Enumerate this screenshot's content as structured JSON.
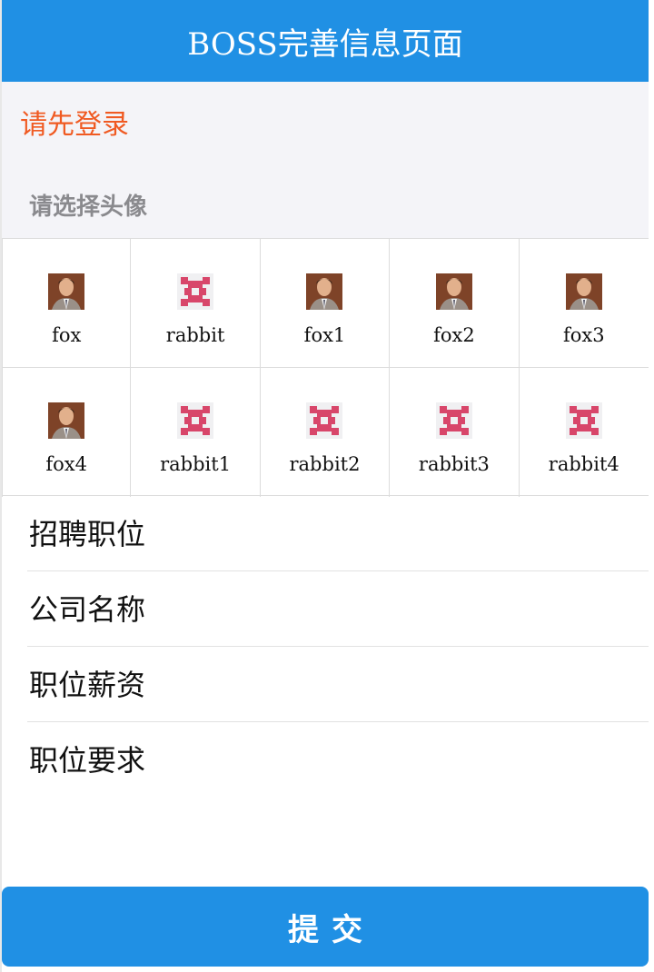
{
  "navbar": {
    "title": "BOSS完善信息页面"
  },
  "login_prompt": "请先登录",
  "avatar_section": {
    "title": "请选择头像",
    "avatars": [
      {
        "label": "fox",
        "icon": "fox-avatar-icon"
      },
      {
        "label": "rabbit",
        "icon": "rabbit-avatar-icon"
      },
      {
        "label": "fox1",
        "icon": "fox-avatar-icon"
      },
      {
        "label": "fox2",
        "icon": "fox-avatar-icon"
      },
      {
        "label": "fox3",
        "icon": "fox-avatar-icon"
      },
      {
        "label": "fox4",
        "icon": "fox-avatar-icon"
      },
      {
        "label": "rabbit1",
        "icon": "rabbit-avatar-icon"
      },
      {
        "label": "rabbit2",
        "icon": "rabbit-avatar-icon"
      },
      {
        "label": "rabbit3",
        "icon": "rabbit-avatar-icon"
      },
      {
        "label": "rabbit4",
        "icon": "rabbit-avatar-icon"
      }
    ]
  },
  "form": {
    "fields": [
      {
        "label": "招聘职位",
        "value": ""
      },
      {
        "label": "公司名称",
        "value": ""
      },
      {
        "label": "职位薪资",
        "value": ""
      },
      {
        "label": "职位要求",
        "value": ""
      }
    ]
  },
  "submit_label": "提交",
  "colors": {
    "primary": "#2090e4",
    "warning": "#f05a22",
    "muted": "#8a8a8e"
  }
}
